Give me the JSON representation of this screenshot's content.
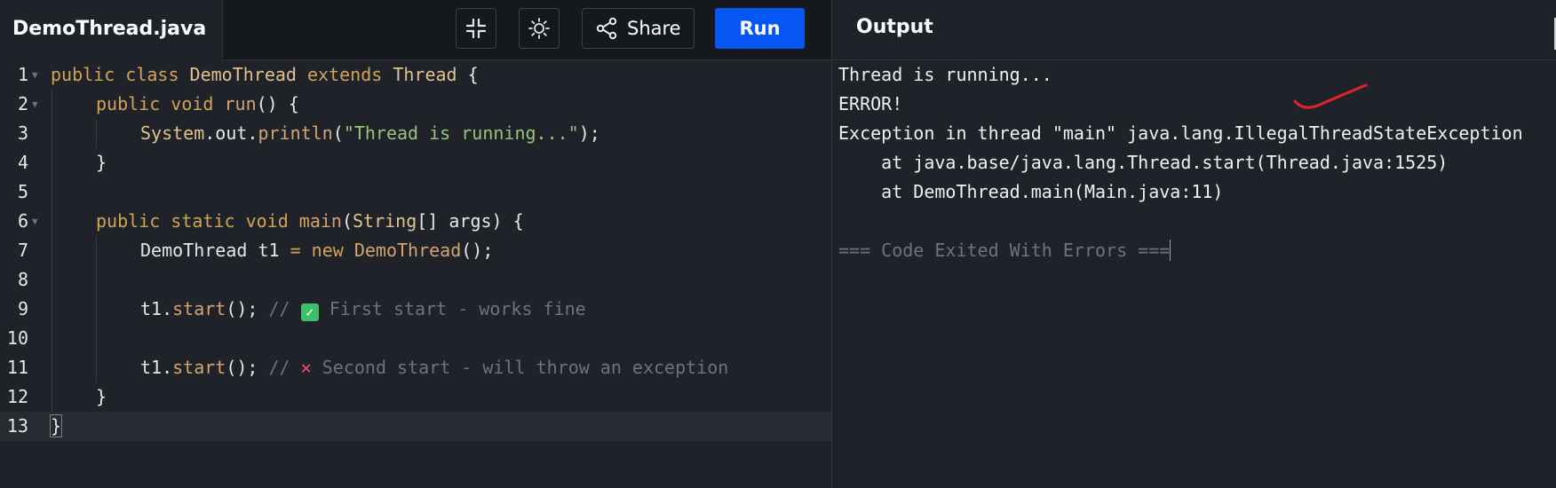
{
  "header": {
    "filename": "DemoThread.java",
    "share_label": "Share",
    "run_label": "Run",
    "output_title": "Output"
  },
  "editor": {
    "line_numbers": [
      "1",
      "2",
      "3",
      "4",
      "5",
      "6",
      "7",
      "8",
      "9",
      "10",
      "11",
      "12",
      "13"
    ],
    "lines": {
      "l1": {
        "kw1": "public class ",
        "name": "DemoThread",
        "kw2": " extends ",
        "parent": "Thread",
        "brace": " {"
      },
      "l2": {
        "kw": "public void ",
        "fn": "run",
        "rest": "() {"
      },
      "l3": {
        "cls": "System",
        "mid": ".out.",
        "fn": "println",
        "open": "(",
        "str": "\"Thread is running...\"",
        "close": ");"
      },
      "l4": {
        "text": "}"
      },
      "l6": {
        "kw": "public static void ",
        "fn": "main",
        "open": "(",
        "cls": "String",
        "rest": "[] args) {"
      },
      "l7": {
        "a": "DemoThread t1 ",
        "op": "=",
        "kw": " new ",
        "cls": "DemoThread",
        "rest": "();"
      },
      "l9": {
        "a": "t1.",
        "fn": "start",
        "rest": "(); ",
        "cmt": "//",
        "check": "✓",
        "cmt_text": " First start - works fine"
      },
      "l11": {
        "a": "t1.",
        "fn": "start",
        "rest": "(); ",
        "cmt": "//",
        "cross": "✕",
        "cmt_text": " Second start - will throw an exception"
      },
      "l12": {
        "text": "}"
      },
      "l13": {
        "text": "}"
      }
    }
  },
  "output": {
    "lines": [
      "Thread is running...",
      "ERROR!",
      "Exception in thread \"main\" java.lang.IllegalThreadStateException",
      "    at java.base/java.lang.Thread.start(Thread.java:1525)",
      "    at DemoThread.main(Main.java:11)",
      "",
      "=== Code Exited With Errors ==="
    ]
  },
  "icons": {
    "minimize": "minimize-icon",
    "theme": "sun-icon",
    "share": "share-icon"
  },
  "colors": {
    "run_button": "#0556f3",
    "background": "#1f2329",
    "annotation_mark": "#e0242b"
  }
}
